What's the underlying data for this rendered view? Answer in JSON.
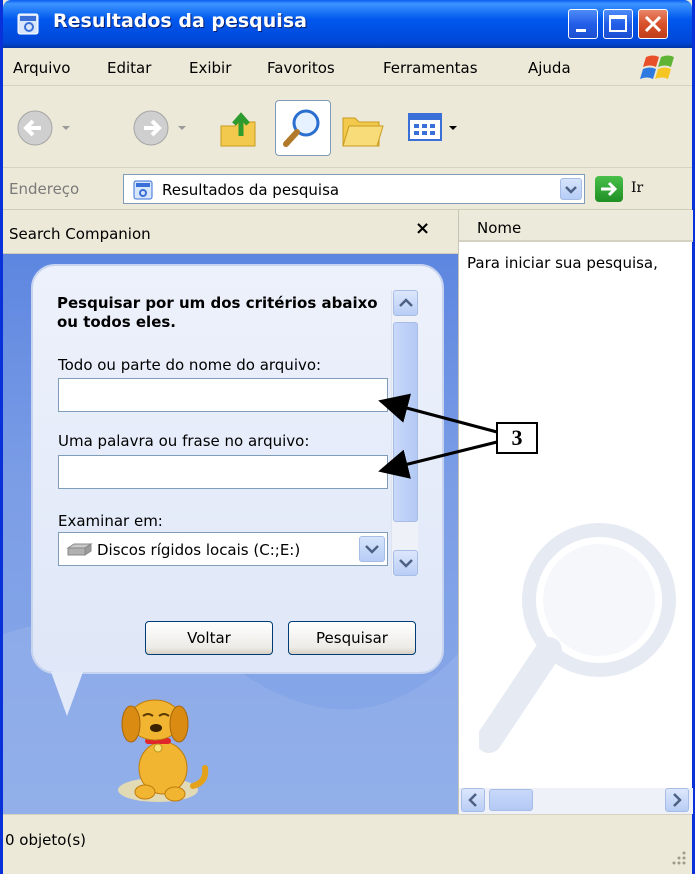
{
  "window": {
    "title": "Resultados da pesquisa",
    "icon": "search-results-icon"
  },
  "title_buttons": {
    "minimize": "minimize-icon",
    "maximize": "maximize-icon",
    "close": "close-icon"
  },
  "menubar": {
    "items": [
      "Arquivo",
      "Editar",
      "Exibir",
      "Favoritos",
      "Ferramentas",
      "Ajuda"
    ]
  },
  "toolbar": {
    "icons": [
      "back-icon",
      "forward-icon",
      "up-folder-icon",
      "search-icon",
      "folders-icon",
      "views-icon"
    ]
  },
  "address": {
    "label": "Endereço",
    "value": "Resultados da pesquisa",
    "go_label": "Ir"
  },
  "companion": {
    "title": "Search Companion",
    "close": "×",
    "hint": "Pesquisar por um dos critérios abaixo ou todos eles.",
    "filename_label": "Todo ou parte do nome do arquivo:",
    "filename_value": "",
    "phrase_label": "Uma palavra ou frase no arquivo:",
    "phrase_value": "",
    "lookin_label": "Examinar em:",
    "lookin_value": "Discos rígidos locais (C:;E:)",
    "back_button": "Voltar",
    "search_button": "Pesquisar"
  },
  "results": {
    "column_name": "Nome",
    "hint": "Para iniciar sua pesquisa,"
  },
  "status": {
    "text": "0 objeto(s)"
  },
  "callout": {
    "label": "3"
  },
  "colors": {
    "titlebar": "#0058ee",
    "companion_bg": "#7b9de6",
    "bubble": "#e6ecf9"
  }
}
